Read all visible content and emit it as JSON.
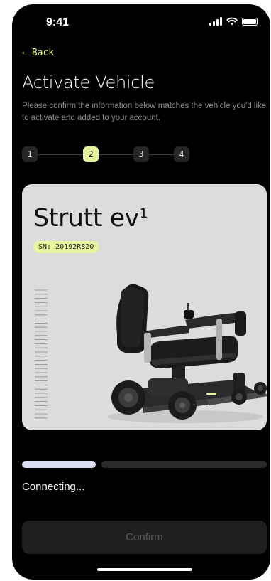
{
  "status_bar": {
    "time": "9:41"
  },
  "nav": {
    "back_label": "Back",
    "back_icon": "arrow-left-icon"
  },
  "page": {
    "title": "Activate Vehicle",
    "description": "Please confirm the information below matches the vehicle you'd like to activate and added to your account."
  },
  "stepper": {
    "steps": [
      "1",
      "2",
      "3",
      "4"
    ],
    "current": 2
  },
  "vehicle": {
    "model": "Strutt ev",
    "model_superscript": "1",
    "serial": "SN: 20192R820"
  },
  "progress": {
    "fraction": 0.3,
    "status": "Connecting..."
  },
  "actions": {
    "confirm_label": "Confirm"
  },
  "colors": {
    "accent": "#e6f39a",
    "background": "#000000",
    "card": "#dcdcdb",
    "progress_fill": "#dcdcf2"
  }
}
